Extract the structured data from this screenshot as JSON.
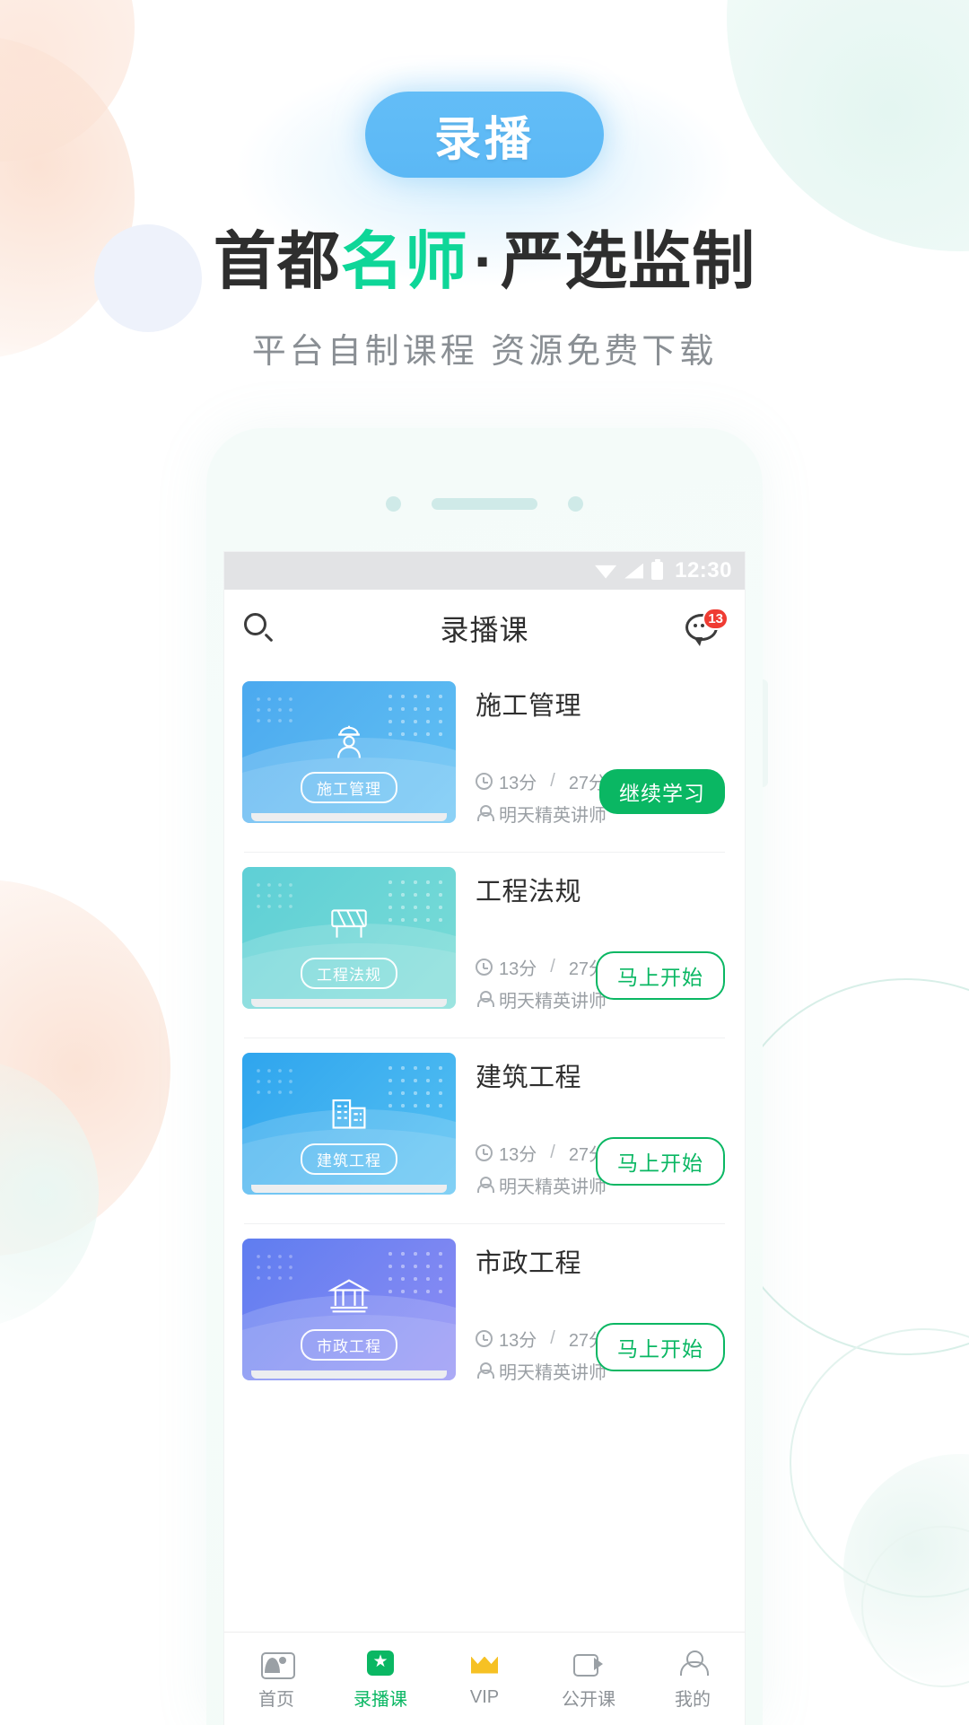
{
  "hero": {
    "badge_label": "录播",
    "badge_color": "#5bb8f5",
    "headline_part1": "首都",
    "headline_highlight": "名师",
    "headline_dot": "·",
    "headline_part2": "严选监制",
    "highlight_color": "#0ed698",
    "subtitle": "平台自制课程 资源免费下载"
  },
  "phone": {
    "statusbar": {
      "time": "12:30"
    },
    "appbar": {
      "title": "录播课",
      "search_icon": "search-icon",
      "chat_icon": "chat-icon",
      "chat_badge": "13",
      "badge_color": "#ef3c33"
    },
    "courses": [
      {
        "title": "施工管理",
        "thumb_tag": "施工管理",
        "thumb_color_start": "#4ba9ef",
        "thumb_color_end": "#63c2f3",
        "glyph": "worker-icon",
        "duration_done": "13分",
        "duration_sep": "/",
        "duration_total": "27分",
        "teacher": "明天精英讲师",
        "button_label": "继续学习",
        "button_style": "primary"
      },
      {
        "title": "工程法规",
        "thumb_tag": "工程法规",
        "thumb_color_start": "#5ecfd6",
        "thumb_color_end": "#74dbd8",
        "glyph": "barrier-icon",
        "duration_done": "13分",
        "duration_sep": "/",
        "duration_total": "27分",
        "teacher": "明天精英讲师",
        "button_label": "马上开始",
        "button_style": "ghost"
      },
      {
        "title": "建筑工程",
        "thumb_tag": "建筑工程",
        "thumb_color_start": "#2fa5ee",
        "thumb_color_end": "#56c1f2",
        "glyph": "building-icon",
        "duration_done": "13分",
        "duration_sep": "/",
        "duration_total": "27分",
        "teacher": "明天精英讲师",
        "button_label": "马上开始",
        "button_style": "ghost"
      },
      {
        "title": "市政工程",
        "thumb_tag": "市政工程",
        "thumb_color_start": "#5f7df0",
        "thumb_color_end": "#8a8df3",
        "glyph": "bank-icon",
        "duration_done": "13分",
        "duration_sep": "/",
        "duration_total": "27分",
        "teacher": "明天精英讲师",
        "button_label": "马上开始",
        "button_style": "ghost"
      }
    ],
    "tabbar": {
      "active_color": "#0ab763",
      "items": [
        {
          "label": "首页",
          "icon": "home-icon"
        },
        {
          "label": "录播课",
          "icon": "star-icon"
        },
        {
          "label": "VIP",
          "icon": "crown-icon"
        },
        {
          "label": "公开课",
          "icon": "video-icon"
        },
        {
          "label": "我的",
          "icon": "person-icon"
        }
      ]
    }
  }
}
